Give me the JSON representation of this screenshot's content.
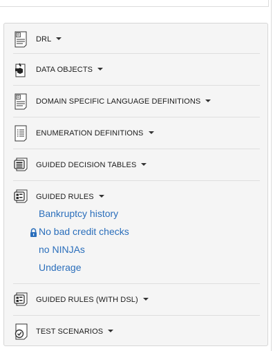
{
  "sections": [
    {
      "label": "DRL",
      "icon": "drl-document-icon"
    },
    {
      "label": "DATA OBJECTS",
      "icon": "data-object-icon"
    },
    {
      "label": "DOMAIN SPECIFIC LANGUAGE DEFINITIONS",
      "icon": "dsl-document-icon"
    },
    {
      "label": "ENUMERATION DEFINITIONS",
      "icon": "enumeration-list-icon"
    },
    {
      "label": "GUIDED DECISION TABLES",
      "icon": "decision-table-icon"
    },
    {
      "label": "GUIDED RULES",
      "icon": "guided-rule-icon"
    },
    {
      "label": "GUIDED RULES (WITH DSL)",
      "icon": "guided-rule-dsl-icon"
    },
    {
      "label": "TEST SCENARIOS",
      "icon": "test-scenario-icon"
    }
  ],
  "guided_rules_items": [
    {
      "label": "Bankruptcy history",
      "locked": false
    },
    {
      "label": "No bad credit checks",
      "locked": true
    },
    {
      "label": "no NINJAs",
      "locked": false
    },
    {
      "label": "Underage",
      "locked": false
    }
  ],
  "colors": {
    "link": "#2a6ebb",
    "lock": "#2a6ebb",
    "panel_bg": "#f5f5f5"
  }
}
